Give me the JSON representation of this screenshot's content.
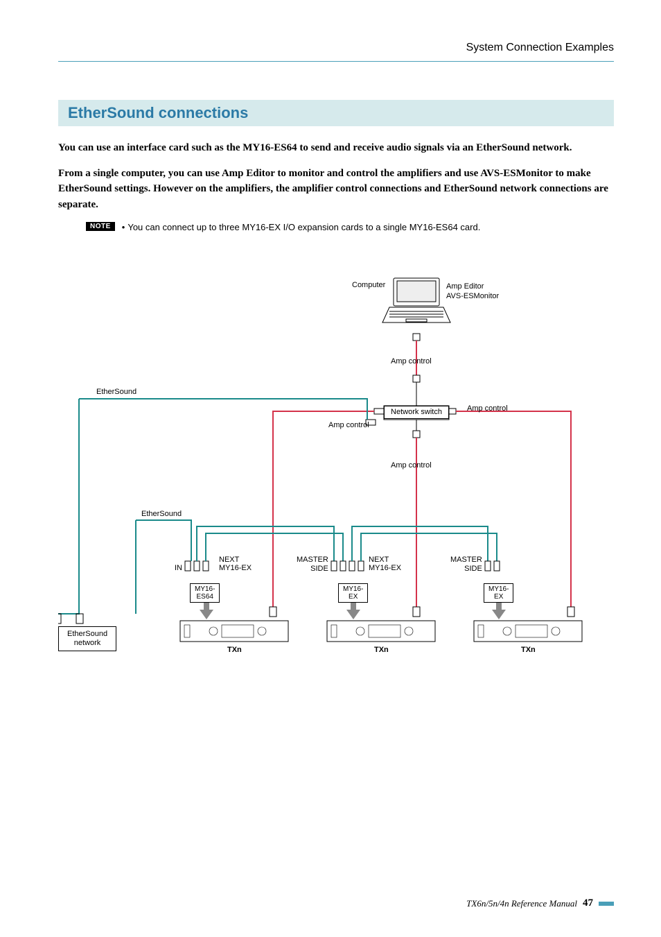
{
  "header": {
    "section_title": "System Connection Examples"
  },
  "section": {
    "heading": "EtherSound connections"
  },
  "paragraphs": {
    "p1": "You can use an interface card such as the MY16-ES64 to send and receive audio signals via an EtherSound network.",
    "p2": "From a single computer, you can use Amp Editor to monitor and control the amplifiers and use AVS-ESMonitor to make EtherSound settings. However on the amplifiers, the amplifier control connections and EtherSound network connections are separate."
  },
  "note": {
    "badge": "NOTE",
    "bullet": "•",
    "text": "You can connect up to three MY16-EX I/O expansion cards to a single MY16-ES64 card."
  },
  "diagram": {
    "computer_label": "Computer",
    "software_labels_line1": "Amp Editor",
    "software_labels_line2": "AVS-ESMonitor",
    "amp_control": "Amp control",
    "ethersound": "EtherSound",
    "network_switch": "Network switch",
    "in": "IN",
    "next": "NEXT",
    "master_side": "MASTER\nSIDE",
    "my16_ex_inline": "MY16-EX",
    "my16_es64_box": "MY16-\nES64",
    "my16_ex_box": "MY16-\nEX",
    "ethersound_network": "EtherSound\nnetwork",
    "txn": "TXn"
  },
  "footer": {
    "manual_name": "TX6n/5n/4n  Reference Manual",
    "page_number": "47"
  },
  "colors": {
    "accent_teal": "#4a9fb8",
    "heading_bg": "#d6eaec",
    "heading_fg": "#2b7aa6",
    "ethersound_teal": "#1a8a8a",
    "amp_control_red": "#d4324a"
  }
}
